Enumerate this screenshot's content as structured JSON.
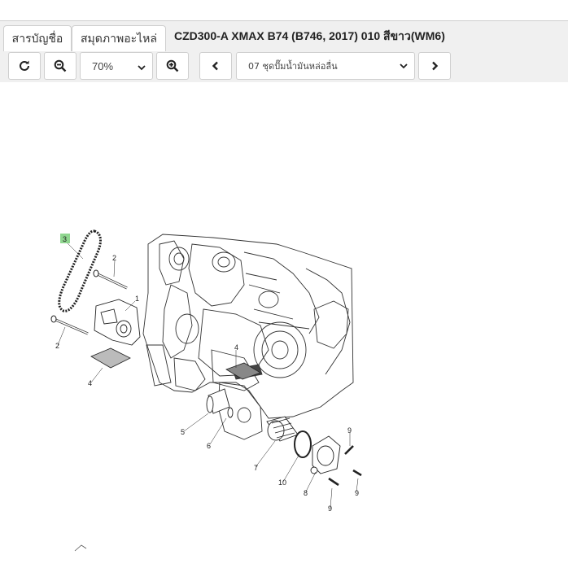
{
  "tabs": [
    {
      "label": "สารบัญชื่อ"
    },
    {
      "label": "สมุดภาพอะไหล่"
    }
  ],
  "page_title": "CZD300-A XMAX B74 (B746, 2017) 010 สีขาว(WM6)",
  "toolbar": {
    "zoom_value": "70%",
    "section_value": "07 ชุดปั๊มน้ำมันหล่อลื่น",
    "icons": {
      "refresh": "refresh-icon",
      "zoom_out": "zoom-out-icon",
      "zoom_in": "zoom-in-icon",
      "prev": "chevron-left-icon",
      "next": "chevron-right-icon"
    }
  },
  "diagram": {
    "callouts": [
      "3",
      "2",
      "1",
      "2",
      "4",
      "4",
      "5",
      "6",
      "7",
      "10",
      "8",
      "9",
      "9",
      "9"
    ],
    "highlighted_callout": "3",
    "highlight_color": "#8fd68f"
  }
}
